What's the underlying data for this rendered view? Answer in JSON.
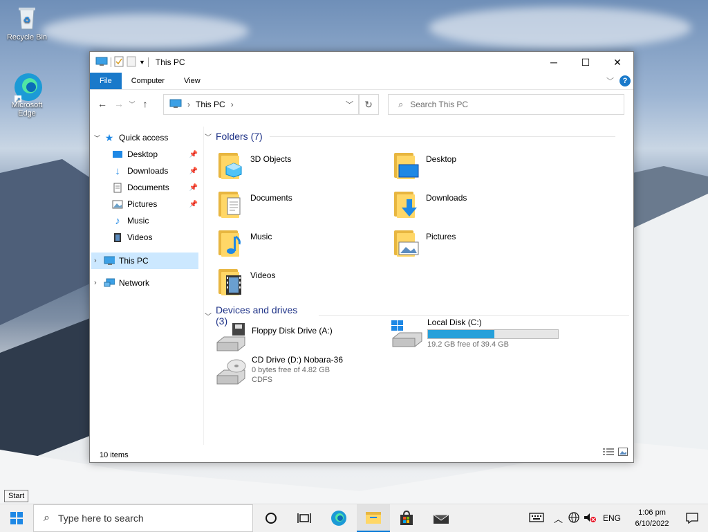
{
  "desktop": {
    "icons": [
      {
        "label": "Recycle Bin"
      },
      {
        "label": "Microsoft Edge"
      }
    ]
  },
  "window": {
    "title": "This PC",
    "ribbon_tabs": [
      {
        "label": "File"
      },
      {
        "label": "Computer"
      },
      {
        "label": "View"
      }
    ],
    "help_label": "?",
    "address_crumb": "This PC",
    "search_placeholder": "Search This PC",
    "nav": {
      "quick_access": "Quick access",
      "items": [
        {
          "label": "Desktop",
          "icon": "desktop-icon"
        },
        {
          "label": "Downloads",
          "icon": "downloads-icon"
        },
        {
          "label": "Documents",
          "icon": "documents-icon"
        },
        {
          "label": "Pictures",
          "icon": "pictures-icon"
        },
        {
          "label": "Music",
          "icon": "music-icon"
        },
        {
          "label": "Videos",
          "icon": "videos-icon"
        }
      ],
      "this_pc": "This PC",
      "network": "Network"
    },
    "folders_header": "Folders (7)",
    "folders": [
      {
        "label": "3D Objects"
      },
      {
        "label": "Desktop"
      },
      {
        "label": "Documents"
      },
      {
        "label": "Downloads"
      },
      {
        "label": "Music"
      },
      {
        "label": "Pictures"
      },
      {
        "label": "Videos"
      }
    ],
    "devices_header": "Devices and drives (3)",
    "drives": {
      "floppy": {
        "label": "Floppy Disk Drive (A:)"
      },
      "local": {
        "label": "Local Disk (C:)",
        "free_text": "19.2 GB free of 39.4 GB",
        "used_fraction": 0.51
      },
      "cd": {
        "label": "CD Drive (D:) Nobara-36",
        "free_text": "0 bytes free of 4.82 GB",
        "fs": "CDFS"
      }
    },
    "status_text": "10 items"
  },
  "taskbar": {
    "start_tooltip": "Start",
    "search_placeholder": "Type here to search",
    "lang": "ENG",
    "time": "1:06 pm",
    "date": "6/10/2022"
  },
  "colors": {
    "accent": "#1979ca",
    "selection": "#cce8ff",
    "folder_yellow": "#ffd767",
    "progress": "#26a0da"
  }
}
